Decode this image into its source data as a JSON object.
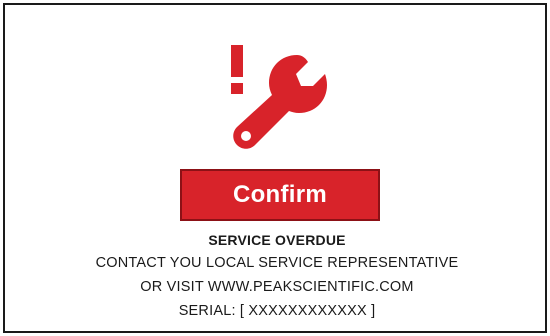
{
  "dialog": {
    "confirm_label": "Confirm",
    "title": "SERVICE OVERDUE",
    "line1": "CONTACT YOU LOCAL SERVICE REPRESENTATIVE",
    "line2": "OR VISIT WWW.PEAKSCIENTIFIC.COM",
    "serial": "SERIAL: [ XXXXXXXXXXXX ]",
    "icon": "service-warning-wrench-icon"
  },
  "colors": {
    "accent": "#d8232a",
    "button_border": "#8c1116",
    "text": "#1a1a1a",
    "background": "#ffffff"
  }
}
